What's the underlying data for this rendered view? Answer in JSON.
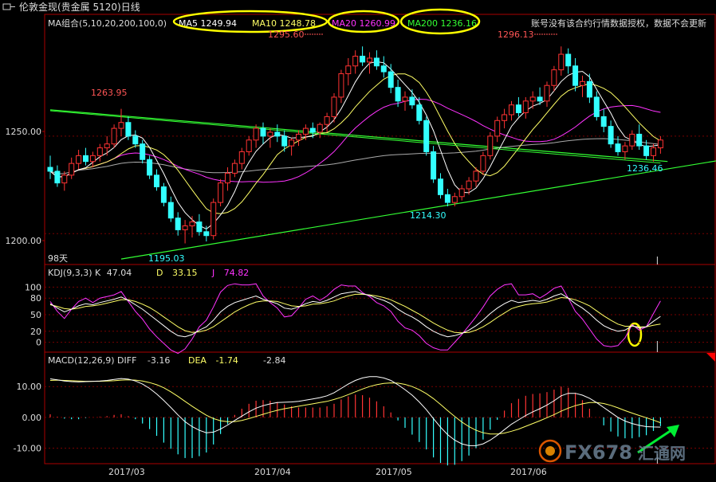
{
  "window": {
    "title": "伦敦金现(贵金属 5120)日线"
  },
  "notice": "账号没有该合约行情数据授权，数据不会更新",
  "price_panel": {
    "indicator_label": "MA组合(5,10,20,200,100,0)",
    "ma": [
      {
        "name": "MA5",
        "value": "1249.94",
        "color": "#ffffff"
      },
      {
        "name": "MA10",
        "value": "1248.78",
        "color": "#ffff66"
      },
      {
        "name": "MA20",
        "value": "1260.99",
        "color": "#ff33ff"
      },
      {
        "name": "MA200",
        "value": "1236.16",
        "color": "#33ff33"
      }
    ],
    "days_label": "98天",
    "y_ticks": [
      "1250.00",
      "1200.00"
    ],
    "annotations": [
      "1263.95",
      "1295.60",
      "1296.13",
      "1195.03",
      "1214.30",
      "1236.46"
    ]
  },
  "kdj_panel": {
    "label": "KDJ(9,3,3)",
    "k_label": "K",
    "k_value": "47.04",
    "d_label": "D",
    "d_value": "33.15",
    "j_label": "J",
    "j_value": "74.82",
    "y_ticks": [
      "100",
      "80",
      "50",
      "20",
      "0"
    ]
  },
  "macd_panel": {
    "label": "MACD(12,26,9)",
    "diff_label": "DIFF",
    "diff_value": "-3.16",
    "dea_label": "DEA",
    "dea_value": "-1.74",
    "macd_value": "-2.84",
    "y_ticks": [
      "10.00",
      "0.00",
      "-10.00"
    ]
  },
  "x_labels": [
    "2017/03",
    "2017/04",
    "2017/05",
    "2017/06"
  ],
  "watermark": {
    "text": "FX678",
    "suffix": "汇通网"
  },
  "colors": {
    "up": "#ff3333",
    "down": "#33ffff",
    "ma5": "#ffffff",
    "ma10": "#ffff66",
    "ma20": "#ff33ff",
    "ma200": "#33ff33",
    "ma_gray": "#aaaaaa",
    "frame": "#aa0000",
    "highlight": "#ffff00"
  },
  "chart_data": {
    "type": "candlestick",
    "ylim": [
      1185,
      1310
    ],
    "kdj_ylim": [
      -15,
      115
    ],
    "macd_ylim": [
      -14,
      16
    ],
    "ohlc": [
      [
        1234,
        1240,
        1228,
        1232
      ],
      [
        1232,
        1235,
        1224,
        1226
      ],
      [
        1226,
        1232,
        1222,
        1230
      ],
      [
        1230,
        1239,
        1228,
        1236
      ],
      [
        1236,
        1243,
        1233,
        1240
      ],
      [
        1240,
        1244,
        1235,
        1237
      ],
      [
        1237,
        1242,
        1234,
        1240
      ],
      [
        1240,
        1246,
        1237,
        1244
      ],
      [
        1244,
        1250,
        1240,
        1246
      ],
      [
        1246,
        1256,
        1244,
        1254
      ],
      [
        1254,
        1264,
        1250,
        1257
      ],
      [
        1257,
        1260,
        1248,
        1250
      ],
      [
        1250,
        1253,
        1244,
        1246
      ],
      [
        1246,
        1248,
        1236,
        1238
      ],
      [
        1238,
        1240,
        1228,
        1230
      ],
      [
        1230,
        1233,
        1222,
        1224
      ],
      [
        1224,
        1226,
        1214,
        1216
      ],
      [
        1216,
        1219,
        1206,
        1208
      ],
      [
        1208,
        1211,
        1199,
        1202
      ],
      [
        1202,
        1207,
        1195,
        1204
      ],
      [
        1204,
        1209,
        1198,
        1206
      ],
      [
        1206,
        1210,
        1199,
        1201
      ],
      [
        1201,
        1204,
        1196,
        1199
      ],
      [
        1199,
        1218,
        1197,
        1216
      ],
      [
        1216,
        1228,
        1214,
        1226
      ],
      [
        1226,
        1234,
        1222,
        1231
      ],
      [
        1231,
        1238,
        1229,
        1236
      ],
      [
        1236,
        1244,
        1233,
        1242
      ],
      [
        1242,
        1250,
        1240,
        1248
      ],
      [
        1248,
        1256,
        1244,
        1254
      ],
      [
        1254,
        1257,
        1246,
        1250
      ],
      [
        1250,
        1254,
        1244,
        1252
      ],
      [
        1252,
        1256,
        1247,
        1250
      ],
      [
        1250,
        1253,
        1242,
        1245
      ],
      [
        1245,
        1249,
        1240,
        1248
      ],
      [
        1248,
        1253,
        1245,
        1251
      ],
      [
        1251,
        1256,
        1248,
        1254
      ],
      [
        1254,
        1257,
        1249,
        1252
      ],
      [
        1252,
        1257,
        1249,
        1256
      ],
      [
        1256,
        1262,
        1252,
        1260
      ],
      [
        1260,
        1272,
        1257,
        1270
      ],
      [
        1270,
        1284,
        1267,
        1282
      ],
      [
        1282,
        1290,
        1276,
        1286
      ],
      [
        1286,
        1294,
        1282,
        1291
      ],
      [
        1291,
        1296,
        1286,
        1288
      ],
      [
        1288,
        1293,
        1282,
        1290
      ],
      [
        1290,
        1294,
        1284,
        1286
      ],
      [
        1286,
        1291,
        1280,
        1283
      ],
      [
        1283,
        1287,
        1272,
        1275
      ],
      [
        1275,
        1279,
        1265,
        1268
      ],
      [
        1268,
        1273,
        1263,
        1270
      ],
      [
        1270,
        1274,
        1264,
        1266
      ],
      [
        1266,
        1270,
        1256,
        1258
      ],
      [
        1258,
        1260,
        1240,
        1242
      ],
      [
        1242,
        1245,
        1226,
        1228
      ],
      [
        1228,
        1231,
        1218,
        1220
      ],
      [
        1220,
        1223,
        1214,
        1216
      ],
      [
        1216,
        1221,
        1214,
        1219
      ],
      [
        1219,
        1225,
        1217,
        1223
      ],
      [
        1223,
        1229,
        1220,
        1227
      ],
      [
        1227,
        1234,
        1224,
        1232
      ],
      [
        1232,
        1242,
        1230,
        1240
      ],
      [
        1240,
        1252,
        1238,
        1250
      ],
      [
        1250,
        1260,
        1247,
        1258
      ],
      [
        1258,
        1264,
        1254,
        1261
      ],
      [
        1261,
        1268,
        1258,
        1266
      ],
      [
        1266,
        1270,
        1260,
        1262
      ],
      [
        1262,
        1270,
        1259,
        1268
      ],
      [
        1268,
        1273,
        1264,
        1270
      ],
      [
        1270,
        1275,
        1266,
        1268
      ],
      [
        1268,
        1278,
        1265,
        1276
      ],
      [
        1276,
        1286,
        1273,
        1284
      ],
      [
        1284,
        1296,
        1281,
        1292
      ],
      [
        1292,
        1295,
        1282,
        1286
      ],
      [
        1286,
        1290,
        1273,
        1276
      ],
      [
        1276,
        1281,
        1270,
        1278
      ],
      [
        1278,
        1282,
        1267,
        1270
      ],
      [
        1270,
        1273,
        1258,
        1260
      ],
      [
        1260,
        1264,
        1252,
        1255
      ],
      [
        1255,
        1258,
        1244,
        1246
      ],
      [
        1246,
        1250,
        1240,
        1242
      ],
      [
        1242,
        1247,
        1238,
        1245
      ],
      [
        1245,
        1253,
        1243,
        1251
      ],
      [
        1251,
        1256,
        1243,
        1245
      ],
      [
        1245,
        1248,
        1238,
        1240
      ],
      [
        1240,
        1246,
        1237,
        1244
      ],
      [
        1244,
        1250,
        1241,
        1248
      ]
    ],
    "kdj": {
      "k": [
        70,
        62,
        55,
        60,
        66,
        70,
        68,
        72,
        75,
        78,
        82,
        76,
        68,
        60,
        50,
        40,
        30,
        20,
        12,
        10,
        14,
        22,
        28,
        40,
        55,
        65,
        72,
        76,
        80,
        84,
        78,
        74,
        70,
        62,
        60,
        64,
        70,
        74,
        72,
        76,
        82,
        88,
        90,
        92,
        88,
        85,
        80,
        76,
        70,
        60,
        52,
        46,
        38,
        28,
        20,
        14,
        10,
        12,
        16,
        22,
        30,
        40,
        52,
        62,
        70,
        76,
        72,
        74,
        76,
        74,
        78,
        84,
        88,
        80,
        70,
        62,
        52,
        40,
        30,
        24,
        20,
        22,
        30,
        26,
        28,
        38,
        47
      ],
      "d": [
        68,
        65,
        61,
        60,
        62,
        65,
        66,
        68,
        71,
        74,
        77,
        77,
        74,
        69,
        63,
        55,
        46,
        37,
        28,
        21,
        18,
        19,
        22,
        28,
        37,
        46,
        55,
        62,
        68,
        73,
        75,
        75,
        74,
        70,
        66,
        65,
        66,
        69,
        70,
        72,
        75,
        80,
        84,
        87,
        87,
        86,
        84,
        81,
        77,
        71,
        65,
        58,
        51,
        43,
        35,
        28,
        22,
        18,
        17,
        18,
        22,
        28,
        36,
        45,
        53,
        61,
        65,
        68,
        70,
        71,
        73,
        77,
        81,
        80,
        77,
        72,
        66,
        57,
        48,
        40,
        33,
        29,
        29,
        28,
        28,
        31,
        33
      ],
      "j": [
        74,
        56,
        43,
        60,
        74,
        80,
        72,
        80,
        83,
        86,
        92,
        74,
        56,
        42,
        24,
        10,
        -2,
        -14,
        -20,
        -12,
        6,
        28,
        40,
        64,
        91,
        103,
        106,
        104,
        104,
        106,
        84,
        72,
        62,
        46,
        48,
        62,
        78,
        84,
        76,
        84,
        96,
        104,
        102,
        102,
        90,
        83,
        72,
        66,
        56,
        38,
        26,
        22,
        12,
        -2,
        -10,
        -14,
        -14,
        0,
        14,
        30,
        46,
        64,
        84,
        96,
        104,
        106,
        86,
        86,
        88,
        80,
        88,
        98,
        102,
        80,
        56,
        42,
        24,
        6,
        -6,
        -8,
        -6,
        8,
        32,
        22,
        28,
        52,
        75
      ]
    },
    "macd": {
      "diff": [
        12.5,
        12.2,
        11.8,
        11.6,
        11.5,
        11.6,
        11.7,
        11.8,
        12,
        12.3,
        12.6,
        12.4,
        11.8,
        10.8,
        9.4,
        7.6,
        5.5,
        3.2,
        0.8,
        -1.4,
        -3,
        -4.2,
        -5,
        -4.8,
        -3.8,
        -2.5,
        -1,
        0.4,
        1.8,
        3,
        3.8,
        4.4,
        4.8,
        4.9,
        5,
        5.2,
        5.6,
        6,
        6.4,
        7,
        8,
        9.4,
        10.8,
        12,
        12.8,
        13.2,
        13.2,
        12.8,
        12,
        10.6,
        9,
        7.2,
        5,
        2.5,
        -0.4,
        -3.2,
        -5.6,
        -7.4,
        -8.6,
        -9.2,
        -9.2,
        -8.6,
        -7.4,
        -5.8,
        -4,
        -2.2,
        -0.8,
        0.6,
        1.8,
        2.8,
        4,
        5.4,
        7,
        7.8,
        7.8,
        7.2,
        6.2,
        4.8,
        3.2,
        1.6,
        0,
        -1.2,
        -2,
        -2.6,
        -3,
        -3.1,
        -3.16
      ],
      "dea": [
        12,
        12.1,
        12,
        11.9,
        11.8,
        11.7,
        11.7,
        11.7,
        11.8,
        11.9,
        12.1,
        12.2,
        12.1,
        11.8,
        11.3,
        10.6,
        9.6,
        8.3,
        6.8,
        5.2,
        3.6,
        2.1,
        0.7,
        -0.4,
        -1.1,
        -1.4,
        -1.4,
        -1,
        -0.4,
        0.3,
        1,
        1.7,
        2.3,
        2.8,
        3.2,
        3.6,
        4,
        4.4,
        4.8,
        5.2,
        5.8,
        6.5,
        7.4,
        8.3,
        9.2,
        10,
        10.6,
        11,
        11.2,
        11.1,
        10.7,
        10,
        9,
        7.7,
        6.1,
        4.2,
        2.2,
        0.3,
        -1.5,
        -3,
        -4.2,
        -5,
        -5.4,
        -5.4,
        -5.1,
        -4.5,
        -3.8,
        -2.9,
        -2,
        -1.1,
        -0.1,
        0.9,
        2,
        3,
        3.8,
        4.4,
        4.8,
        4.8,
        4.5,
        3.9,
        3.1,
        2.2,
        1.4,
        0.6,
        -0.1,
        -0.9,
        -1.74
      ],
      "hist": [
        1,
        0.2,
        -0.4,
        -0.6,
        -0.6,
        -0.2,
        0,
        0.2,
        0.4,
        0.8,
        1,
        0.4,
        -0.6,
        -2,
        -3.8,
        -6,
        -8.2,
        -10.2,
        -12,
        -13.2,
        -13.2,
        -12.6,
        -11.4,
        -8.8,
        -5.4,
        -2.2,
        0.8,
        2.8,
        4.4,
        5.4,
        5.6,
        5.4,
        5,
        4.2,
        3.6,
        3.2,
        3.2,
        3.2,
        3.2,
        3.6,
        4.4,
        5.8,
        6.8,
        7.4,
        7.2,
        6.4,
        5.2,
        3.6,
        1.6,
        -1,
        -3.4,
        -5.6,
        -8,
        -10.4,
        -13,
        -14.8,
        -15.6,
        -15.4,
        -14.2,
        -12.4,
        -10,
        -7.2,
        -4,
        -0.8,
        2.2,
        4.6,
        6,
        7,
        7.6,
        7.8,
        8.2,
        9,
        10,
        9.6,
        8,
        5.6,
        2.8,
        0,
        -2.6,
        -4.6,
        -6.2,
        -6.8,
        -6.8,
        -6.4,
        -5.8,
        -4.4,
        -2.84
      ]
    },
    "trendlines": [
      {
        "from": [
          0,
          1263.5
        ],
        "to": [
          87,
          1237
        ]
      },
      {
        "from": [
          10,
          1187
        ],
        "to": [
          100,
          1241
        ]
      }
    ]
  }
}
